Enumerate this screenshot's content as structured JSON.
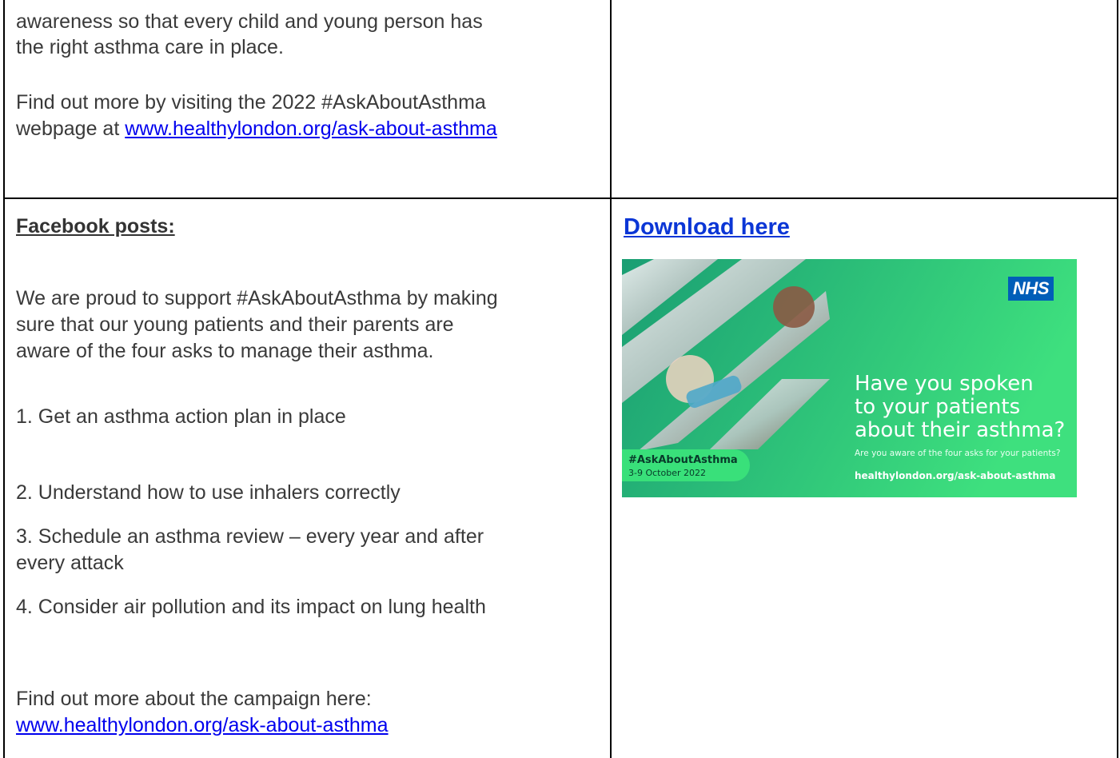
{
  "top_left": {
    "paragraph_lines": [
      "awareness so that every child and young person has",
      "the right asthma care in place."
    ],
    "find_out_line1": "Find out more by visiting the 2022 #AskAboutAsthma",
    "find_out_prefix": "webpage at ",
    "find_out_link": "www.healthylondon.org/ask-about-asthma"
  },
  "facebook": {
    "heading": "Facebook posts:",
    "intro_lines": [
      "We are proud to support #AskAboutAsthma by making",
      "sure that our young patients and their parents are",
      "aware of the four asks to manage their asthma."
    ],
    "asks": [
      "1. Get an asthma action plan in place",
      "2. Understand how to use inhalers correctly",
      "3. Schedule an asthma review – every year and after",
      "every attack",
      "4. Consider air pollution and its impact on lung health"
    ],
    "find_out_text": "Find out more about the campaign here:",
    "find_out_link": "www.healthylondon.org/ask-about-asthma"
  },
  "download": {
    "label": "Download here"
  },
  "promo_image": {
    "logo": "NHS",
    "headline_lines": [
      "Have you spoken",
      "to your patients",
      "about their asthma?"
    ],
    "subtext": "Are you aware of the four asks for your patients?",
    "url": "healthylondon.org/ask-about-asthma",
    "tag_line1": "#AskAboutAsthma",
    "tag_line2": "3-9 October 2022",
    "colors": {
      "green_start": "#1a9e73",
      "green_end": "#3ee07e",
      "nhs_blue": "#005eb8"
    }
  }
}
